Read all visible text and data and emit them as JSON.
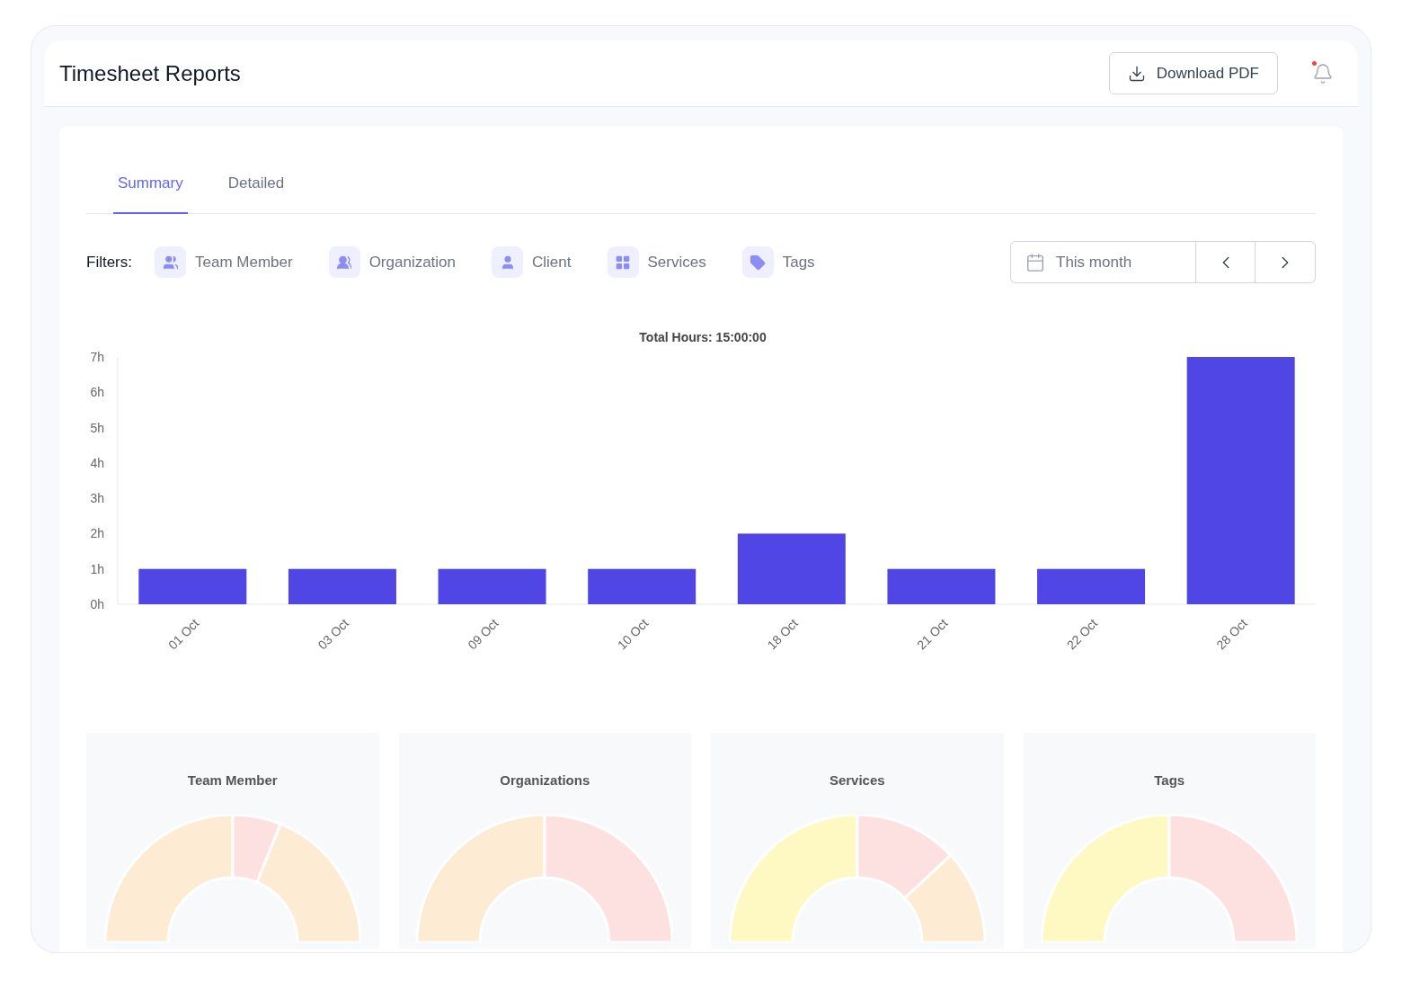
{
  "header": {
    "title": "Timesheet Reports",
    "download_button": "Download PDF",
    "notifications": {
      "unread": true
    }
  },
  "tabs": [
    {
      "label": "Summary",
      "selected": true
    },
    {
      "label": "Detailed",
      "selected": false
    }
  ],
  "filters": {
    "label": "Filters:",
    "items": [
      "Team Member",
      "Organization",
      "Client",
      "Services",
      "Tags"
    ]
  },
  "date_range": {
    "value": "This month"
  },
  "chart": {
    "chart_data": {
      "type": "bar",
      "title": "Total Hours: 15:00:00",
      "categories": [
        "01 Oct",
        "03 Oct",
        "09 Oct",
        "10 Oct",
        "18 Oct",
        "21 Oct",
        "22 Oct",
        "28 Oct"
      ],
      "series": [
        {
          "color": "#4f46e5",
          "values": [
            1,
            1,
            1,
            1,
            2,
            1,
            1,
            7
          ]
        }
      ],
      "ylim": [
        0,
        7
      ],
      "yticks": [
        {
          "value": 0,
          "label": "0h"
        },
        {
          "value": 1,
          "label": "1h"
        },
        {
          "value": 2,
          "label": "2h"
        },
        {
          "value": 3,
          "label": "3h"
        },
        {
          "value": 4,
          "label": "4h"
        },
        {
          "value": 5,
          "label": "5h"
        },
        {
          "value": 6,
          "label": "6h"
        },
        {
          "value": 7,
          "label": "7h"
        }
      ]
    }
  },
  "breakdowns": [
    {
      "title": "Team Member"
    },
    {
      "title": "Organizations"
    },
    {
      "title": "Services"
    },
    {
      "title": "Tags"
    }
  ]
}
